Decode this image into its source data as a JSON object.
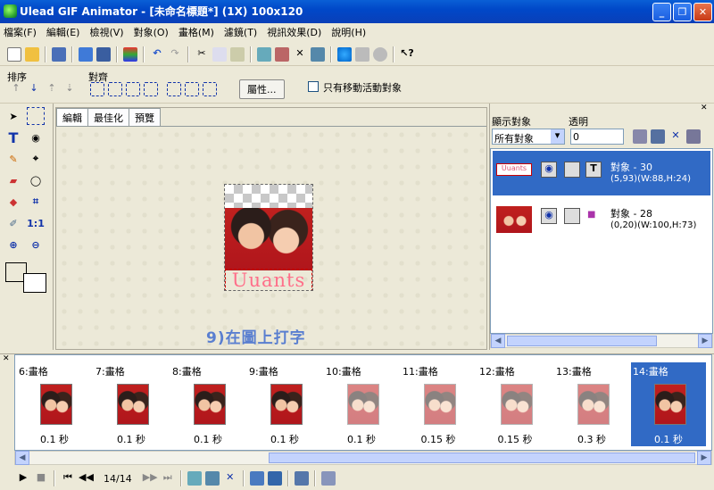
{
  "window": {
    "title": "Ulead GIF Animator - [未命名標題*] (1X) 100x120",
    "minimize": "_",
    "maximize": "❐",
    "close": "✕"
  },
  "menu": [
    "檔案(F)",
    "編輯(E)",
    "檢視(V)",
    "對象(O)",
    "畫格(M)",
    "濾鏡(T)",
    "視訊效果(D)",
    "說明(H)"
  ],
  "arrange": {
    "label": "排序",
    "align_label": "對齊",
    "properties_button": "屬性...",
    "only_move_active": "只有移動活動對象"
  },
  "tabs": [
    "編輯",
    "最佳化",
    "預覽"
  ],
  "canvas": {
    "caption": "Uuants",
    "handwriting": "9)在圖上打字"
  },
  "right": {
    "show_label": "顯示對象",
    "opacity_label": "透明",
    "show_value": "所有對象",
    "opacity_value": "0",
    "objects": [
      {
        "name": "對象 - 30",
        "info": "(5,93)(W:88,H:24)",
        "thumb": "Uuants",
        "type_icon": "T"
      },
      {
        "name": "對象 - 28",
        "info": "(0,20)(W:100,H:73)",
        "type_icon": "■"
      }
    ]
  },
  "frames": [
    {
      "label": "6:畫格",
      "delay": "0.1 秒"
    },
    {
      "label": "7:畫格",
      "delay": "0.1 秒"
    },
    {
      "label": "8:畫格",
      "delay": "0.1 秒"
    },
    {
      "label": "9:畫格",
      "delay": "0.1 秒"
    },
    {
      "label": "10:畫格",
      "delay": "0.1 秒"
    },
    {
      "label": "11:畫格",
      "delay": "0.15 秒"
    },
    {
      "label": "12:畫格",
      "delay": "0.15 秒"
    },
    {
      "label": "13:畫格",
      "delay": "0.3 秒"
    },
    {
      "label": "14:畫格",
      "delay": "0.1 秒"
    }
  ],
  "playback": {
    "counter": "14/14"
  },
  "colors": {
    "title_bar": "#0a4fd0",
    "selection": "#316ac5"
  }
}
